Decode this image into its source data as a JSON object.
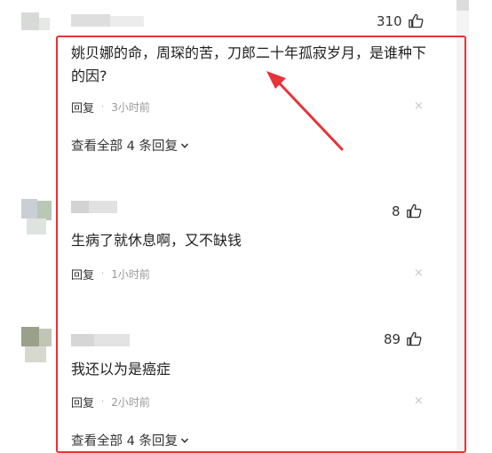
{
  "comments": [
    {
      "likes": "310",
      "text": "姚贝娜的命，周琛的苦，刀郎二十年孤寂岁月，是谁种下的因?",
      "reply": "回复",
      "time": "3小时前",
      "view_all": "查看全部 4 条回复"
    },
    {
      "likes": "8",
      "text": "生病了就休息啊，又不缺钱",
      "reply": "回复",
      "time": "1小时前"
    },
    {
      "likes": "89",
      "text": "我还以为是癌症",
      "reply": "回复",
      "time": "2小时前",
      "view_all": "查看全部 4 条回复"
    }
  ],
  "icons": {
    "like": "thumbs-up-icon",
    "close": "close-icon",
    "expand": "chevron-down-icon"
  },
  "colors": {
    "highlight": "#e5343a",
    "arrow": "#e5343a"
  },
  "close_glyph": "×",
  "dot_glyph": "·"
}
